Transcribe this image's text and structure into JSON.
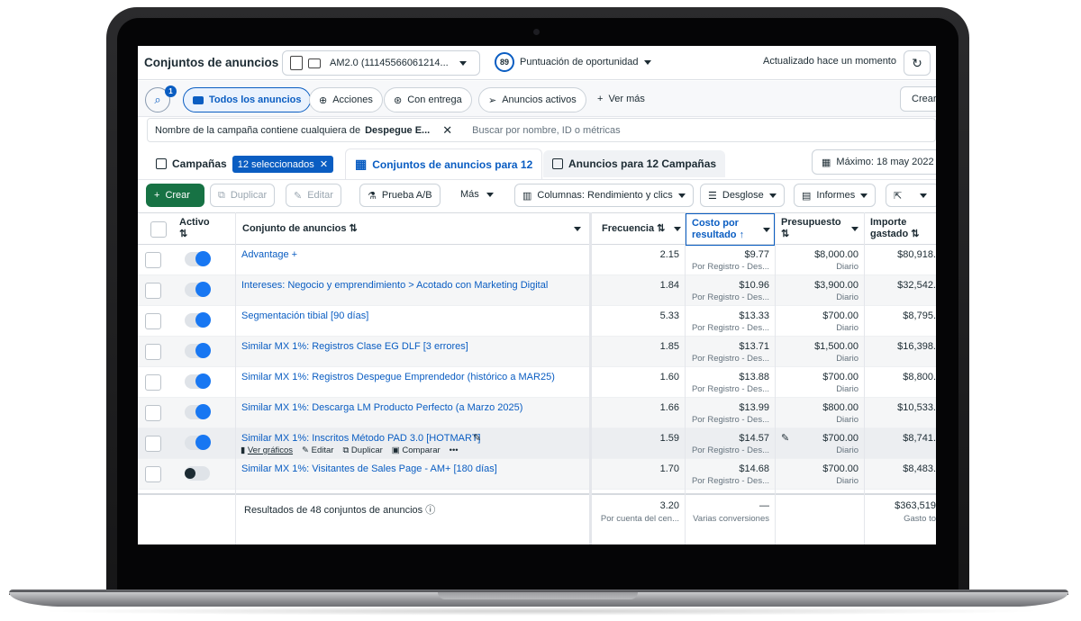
{
  "topbar": {
    "title": "Conjuntos de anuncios",
    "account": "AM2.0 (11145566061214...",
    "score": "89",
    "score_label": "Puntuación de oportunidad",
    "updated": "Actualizado hace un momento"
  },
  "chips": {
    "search_count": "1",
    "all_ads": "Todos los anuncios",
    "actions": "Acciones",
    "delivery": "Con entrega",
    "active_ads": "Anuncios activos",
    "see_more": "Ver más",
    "create": "Crear"
  },
  "filter": {
    "prefix": "Nombre de la campaña contiene cualquiera de",
    "value": "Despegue E...",
    "search_placeholder": "Buscar por nombre, ID o métricas"
  },
  "tabs": {
    "campaigns": "Campañas",
    "selected": "12 seleccionados",
    "adsets": "Conjuntos de anuncios para 12",
    "ads": "Anuncios para 12 Campañas",
    "date": "Máximo: 18 may 2022 -"
  },
  "toolbar": {
    "create": "Crear",
    "duplicate": "Duplicar",
    "edit": "Editar",
    "ab_test": "Prueba A/B",
    "more": "Más",
    "columns": "Columnas: Rendimiento y clics",
    "breakdown": "Desglose",
    "reports": "Informes"
  },
  "table": {
    "headers": {
      "active": "Activo",
      "active_sort": "⇅",
      "adset": "Conjunto de anuncios ⇅",
      "frequency": "Frecuencia ⇅",
      "cost": "Costo por",
      "cost2": "resultado ↑",
      "budget": "Presupuesto",
      "budget_sort": "⇅",
      "spent": "Importe",
      "spent2": "gastado ⇅"
    },
    "rows": [
      {
        "name": "Advantage +",
        "frequency": "2.15",
        "cost": "$9.77",
        "cost_sub": "Por Registro - Des...",
        "budget": "$8,000.00",
        "budget_sub": "Diario",
        "spent": "$80,918.",
        "on": true
      },
      {
        "name": "Intereses: Negocio y emprendimiento > Acotado con Marketing Digital",
        "frequency": "1.84",
        "cost": "$10.96",
        "cost_sub": "Por Registro - Des...",
        "budget": "$3,900.00",
        "budget_sub": "Diario",
        "spent": "$32,542.",
        "on": true
      },
      {
        "name": "Segmentación tibial [90 días]",
        "frequency": "5.33",
        "cost": "$13.33",
        "cost_sub": "Por Registro - Des...",
        "budget": "$700.00",
        "budget_sub": "Diario",
        "spent": "$8,795.",
        "on": true
      },
      {
        "name": "Similar MX 1%: Registros Clase EG DLF [3 errores]",
        "frequency": "1.85",
        "cost": "$13.71",
        "cost_sub": "Por Registro - Des...",
        "budget": "$1,500.00",
        "budget_sub": "Diario",
        "spent": "$16,398.",
        "on": true
      },
      {
        "name": "Similar MX 1%: Registros Despegue Emprendedor (histórico a MAR25)",
        "frequency": "1.60",
        "cost": "$13.88",
        "cost_sub": "Por Registro - Des...",
        "budget": "$700.00",
        "budget_sub": "Diario",
        "spent": "$8,800.",
        "on": true
      },
      {
        "name": "Similar MX 1%: Descarga LM Producto Perfecto (a Marzo 2025)",
        "frequency": "1.66",
        "cost": "$13.99",
        "cost_sub": "Por Registro - Des...",
        "budget": "$800.00",
        "budget_sub": "Diario",
        "spent": "$10,533.",
        "on": true
      },
      {
        "name": "Similar MX 1%: Inscritos Método PAD 3.0 [HOTMART]",
        "frequency": "1.59",
        "cost": "$14.57",
        "cost_sub": "Por Registro - Des...",
        "budget": "$700.00",
        "budget_sub": "Diario",
        "spent": "$8,741.",
        "on": true
      },
      {
        "name": "Similar MX 1%: Visitantes de Sales Page - AM+ [180 días]",
        "frequency": "1.70",
        "cost": "$14.68",
        "cost_sub": "Por Registro - Des...",
        "budget": "$700.00",
        "budget_sub": "Diario",
        "spent": "$8,483.",
        "on": false
      }
    ],
    "row_actions": {
      "charts": "Ver gráficos",
      "edit": "Editar",
      "duplicate": "Duplicar",
      "compare": "Comparar",
      "more": "•••"
    },
    "footer": {
      "label": "Resultados de 48 conjuntos de anuncios",
      "frequency": "3.20",
      "frequency_sub": "Por cuenta del cen...",
      "cost": "—",
      "cost_sub": "Varias conversiones",
      "spent": "$363,519",
      "spent_sub": "Gasto to"
    }
  },
  "colors": {
    "accent": "#0a5dc2",
    "toggle_on": "#1877f2",
    "create_green": "#177244"
  }
}
